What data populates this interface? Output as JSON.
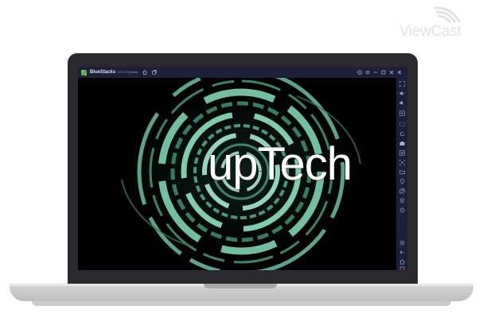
{
  "watermark": {
    "text": "ViewCast"
  },
  "window": {
    "app_title": "BlueStacks",
    "version": "5.0.0.7228 Beta",
    "titlebar_icons": [
      "home-icon",
      "multi-instance-icon"
    ],
    "controls": [
      "help-icon",
      "menu-icon",
      "minimize-icon",
      "maximize-icon",
      "close-icon"
    ]
  },
  "sidebar": {
    "items": [
      "fullscreen-icon",
      "volume-up-icon",
      "volume-down-icon",
      "screen-record-icon",
      "keyboard-controls-icon",
      "rotate-icon",
      "camera-icon",
      "macros-icon",
      "screenshot-icon",
      "media-folder-icon",
      "location-icon",
      "multi-instance-icon",
      "eco-mode-icon",
      "settings-icon",
      "back-icon",
      "home-icon",
      "recent-apps-icon"
    ]
  },
  "app": {
    "logo_text": "upTech"
  },
  "colors": {
    "accent": "#5fb99a",
    "titlebar": "#1d1f3a",
    "lid": "#2a2a2e"
  }
}
